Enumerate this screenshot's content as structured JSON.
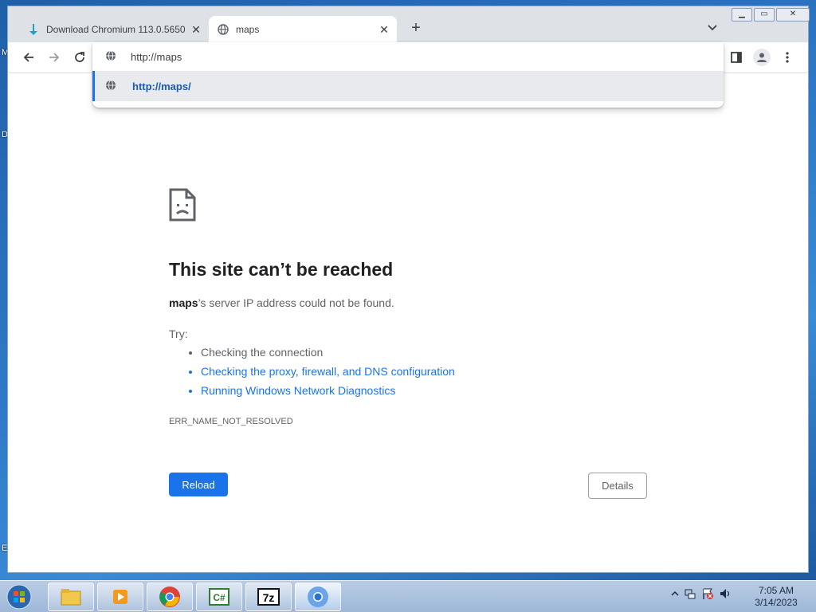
{
  "tabs": [
    {
      "title": "Download Chromium 113.0.5650",
      "active": false
    },
    {
      "title": "maps",
      "active": true
    }
  ],
  "omnibox": {
    "input_value": "http://maps",
    "suggestion": "http://maps/"
  },
  "error": {
    "title": "This site can’t be reached",
    "host": "maps",
    "message_rest": "’s server IP address could not be found.",
    "try_label": "Try:",
    "suggestions": [
      "Checking the connection",
      "Checking the proxy, firewall, and DNS configuration",
      "Running Windows Network Diagnostics"
    ],
    "code": "ERR_NAME_NOT_RESOLVED",
    "reload_label": "Reload",
    "details_label": "Details"
  },
  "taskbar": {
    "time": "7:05 AM",
    "date": "3/14/2023"
  },
  "colors": {
    "accent": "#1a73e8",
    "tabstrip": "#dee1e6"
  }
}
